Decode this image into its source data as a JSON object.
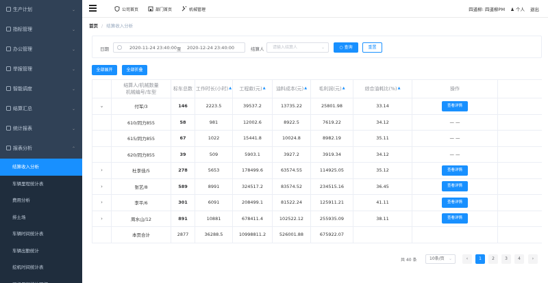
{
  "sidebar": {
    "menus": [
      {
        "label": "生产计划",
        "expanded": false
      },
      {
        "label": "指标管理",
        "expanded": false
      },
      {
        "label": "办公管理",
        "expanded": false
      },
      {
        "label": "举报管理",
        "expanded": false
      },
      {
        "label": "智能调度",
        "expanded": false
      },
      {
        "label": "结算汇总",
        "expanded": false
      },
      {
        "label": "统计报表",
        "expanded": false
      },
      {
        "label": "报表分析",
        "expanded": true
      }
    ],
    "submenu": [
      "结算收入分析",
      "车辆里程统计表",
      "费用分析",
      "排土场",
      "车辆时间统计表",
      "车辆出勤统计",
      "挖机时间统计表",
      "司机里程统计明细"
    ],
    "active_sub": "结算收入分析"
  },
  "topbar": {
    "nav": [
      "公司首页",
      "部门首页",
      "机械管理"
    ],
    "user_org": "四道柳: 四道柳PM",
    "personal": "个人",
    "logout": "退出"
  },
  "breadcrumb": {
    "home": "首页",
    "current": "结算收入分析"
  },
  "filter": {
    "date_label": "日期",
    "date_start": "2020-11-24 23:40:00",
    "date_sep": "至",
    "date_end": "2020-12-24 23:40:00",
    "settler_label": "结算人",
    "settler_placeholder": "请输入结算人",
    "search_btn": "查询",
    "reset_btn": "重置"
  },
  "actions": {
    "expand_all": "全部展开",
    "collapse_all": "全部折叠"
  },
  "table": {
    "headers": {
      "settler_top": "结算人/机械数量",
      "settler_bottom": "机械编号/车型",
      "total": "标车总数",
      "hours": "工作时长(小时)",
      "amount": "工程款(元)",
      "fuel": "油料成本(元)",
      "profit": "毛利润(元)",
      "ratio": "综合油耗比(%)",
      "op": "操作"
    },
    "view_label": "查看详情",
    "dash": "— —",
    "rows": [
      {
        "kind": "parent",
        "expanded": true,
        "name": "付军/3",
        "total": "146",
        "hours": "2223.5",
        "amount": "39537.2",
        "fuel": "13735.22",
        "profit": "25801.98",
        "ratio": "33.14"
      },
      {
        "kind": "child",
        "name": "610/同力855",
        "total": "58",
        "hours": "981",
        "amount": "12002.6",
        "fuel": "8922.5",
        "profit": "7619.22",
        "ratio": "34.12"
      },
      {
        "kind": "child",
        "name": "615/同力855",
        "total": "67",
        "hours": "1022",
        "amount": "15441.8",
        "fuel": "10024.8",
        "profit": "8982.19",
        "ratio": "35.11"
      },
      {
        "kind": "child",
        "name": "620/同力855",
        "total": "39",
        "hours": "509",
        "amount": "5903.1",
        "fuel": "3927.2",
        "profit": "3919.34",
        "ratio": "34.12"
      },
      {
        "kind": "parent",
        "expanded": false,
        "name": "杜李佳/5",
        "total": "278",
        "hours": "5653",
        "amount": "178499.6",
        "fuel": "63574.55",
        "profit": "114925.05",
        "ratio": "35.12"
      },
      {
        "kind": "parent",
        "expanded": false,
        "name": "张艺/8",
        "total": "589",
        "hours": "8991",
        "amount": "324517.2",
        "fuel": "83574.52",
        "profit": "234515.16",
        "ratio": "36.45"
      },
      {
        "kind": "parent",
        "expanded": false,
        "name": "李平/6",
        "total": "301",
        "hours": "6091",
        "amount": "208499.1",
        "fuel": "81522.24",
        "profit": "125911.21",
        "ratio": "41.11"
      },
      {
        "kind": "parent",
        "expanded": false,
        "name": "周水山/12",
        "total": "891",
        "hours": "10881",
        "amount": "678411.4",
        "fuel": "102522.12",
        "profit": "255935.09",
        "ratio": "38.11"
      }
    ],
    "summary": {
      "name": "本页合计",
      "total": "2877",
      "hours": "36288.5",
      "amount": "10998811.2",
      "fuel": "526001.88",
      "profit": "675922.07"
    }
  },
  "pager": {
    "total": "共 40 条",
    "page_size": "10条/页",
    "pages": [
      "1",
      "2",
      "3",
      "4"
    ],
    "current": "1",
    "prev": "‹",
    "next": "›"
  },
  "colors": {
    "sidebar_bg": "#304156",
    "sidebar_active": "#1890ff",
    "primary": "#1890ff"
  }
}
